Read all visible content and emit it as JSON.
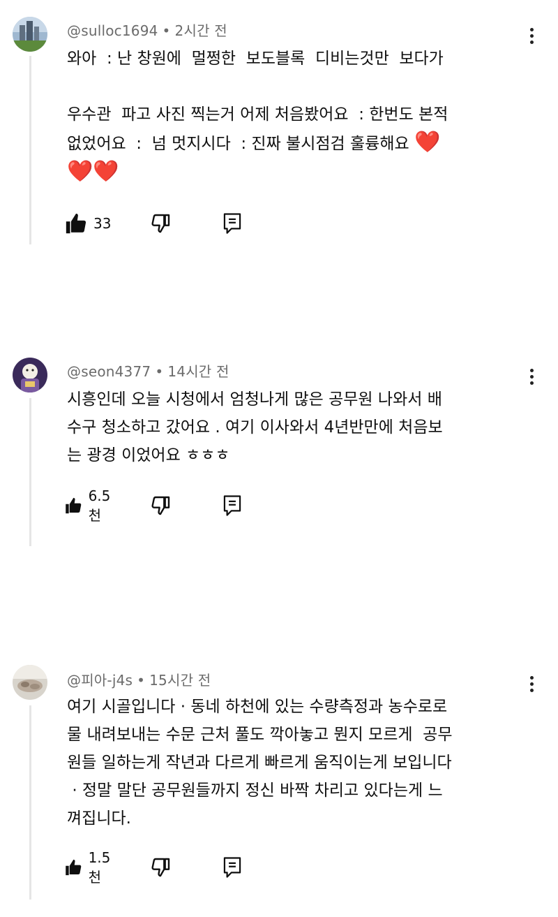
{
  "comments": [
    {
      "username": "@sulloc1694",
      "separator": "•",
      "time": "2시간 전",
      "lines": [
        "와아  : 난 창원에  멀쩡한  보도블록  디비는것만  보다가",
        "",
        "우수관  파고 사진 찍는거 어제 처음봤어요  : 한번도 본적",
        "없었어요  :  넘 멋지시다  : 진짜 불시점검 훌륭해요 "
      ],
      "hearts_line3": "❤️",
      "hearts_line4": "❤️❤️",
      "likes": "33"
    },
    {
      "username": "@seon4377",
      "separator": "•",
      "time": "14시간 전",
      "lines": [
        "시흥인데 오늘 시청에서 엄청나게 많은 공무원 나와서 배",
        "수구 청소하고 갔어요 . 여기 이사와서 4년반만에 처음보",
        "는 광경 이었어요 ㅎㅎㅎ"
      ],
      "likes": "6.5천"
    },
    {
      "username": "@피아-j4s",
      "separator": "•",
      "time": "15시간 전",
      "lines": [
        "여기 시골입니다 · 동네 하천에 있는 수량측정과 농수로로",
        "물 내려보내는 수문 근처 풀도 깍아놓고 뭔지 모르게  공무",
        "원들 일하는게 작년과 다르게 빠르게 움직이는게 보입니다",
        " · 정말 말단 공무원들까지 정신 바짝 차리고 있다는게 느",
        "껴집니다."
      ],
      "likes": "1.5천"
    }
  ],
  "icons": {
    "like": "thumbs-up-icon",
    "dislike": "thumbs-down-icon",
    "reply": "reply-icon",
    "more": "more-vertical-icon"
  },
  "colors": {
    "text": "#0f0f0f",
    "meta": "#6b6b6b",
    "thread_line": "#e5e5e5",
    "heart": "#e0141e"
  }
}
